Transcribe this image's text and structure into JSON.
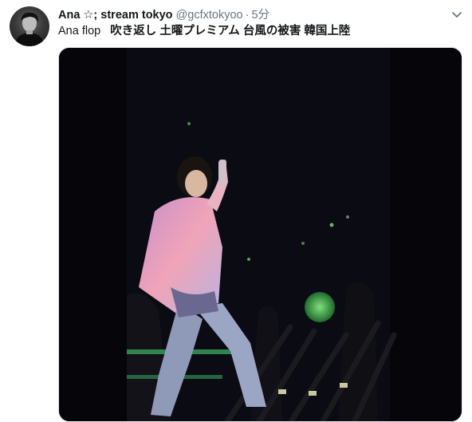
{
  "tweet": {
    "display_name": "Ana ☆; stream tokyo",
    "handle": "@gcfxtokyoo",
    "separator": "·",
    "time": "5分",
    "text_lead": "Ana flop   ",
    "text_tags": "吹き返し 土曜プレミアム 台風の被害 韓国上陸",
    "menu_icon": "chevron-down-icon",
    "avatar_icon": "profile-photo",
    "media_description_icon": "video-still"
  },
  "colors": {
    "name": "#14171a",
    "secondary": "#657786",
    "media_bg": "#000000"
  }
}
